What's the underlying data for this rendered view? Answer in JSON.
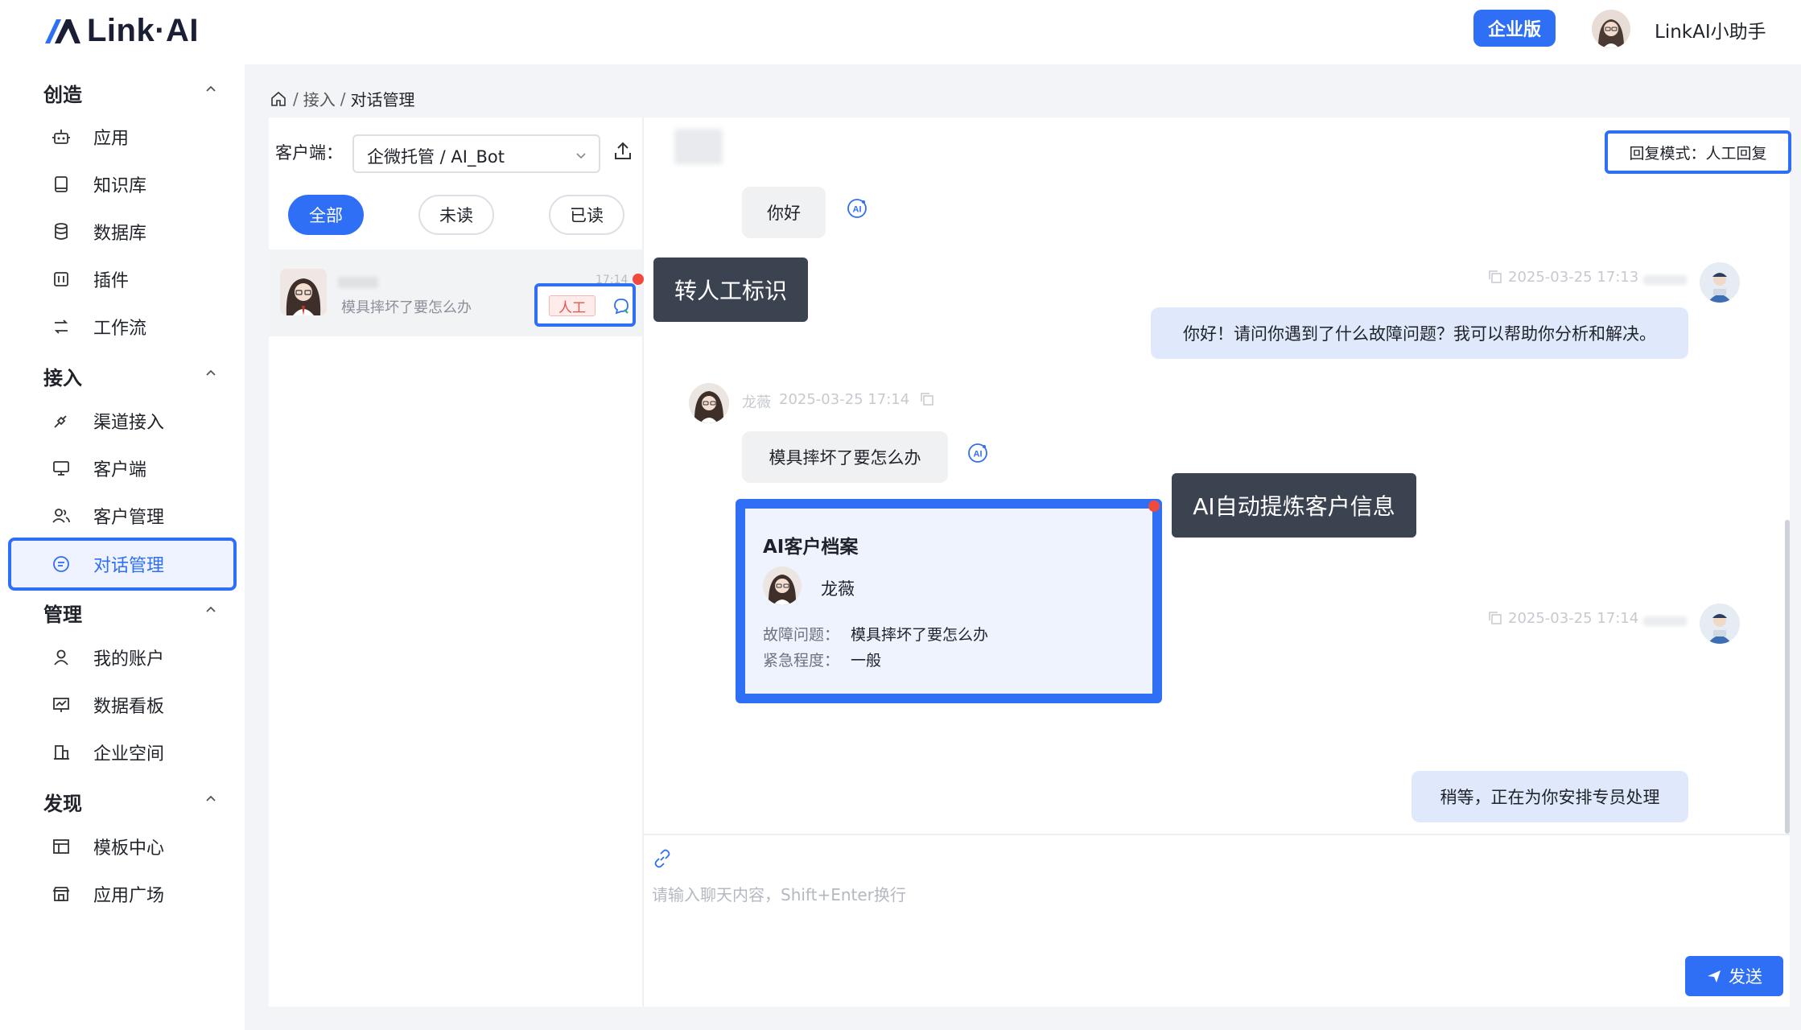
{
  "app": {
    "logo_text": "Link·AI"
  },
  "header": {
    "enterprise_label": "企业版",
    "username": "LinkAI小助手"
  },
  "sidebar": {
    "groups": [
      {
        "title": "创造",
        "items": [
          {
            "label": "应用",
            "icon": "robot-icon"
          },
          {
            "label": "知识库",
            "icon": "book-icon"
          },
          {
            "label": "数据库",
            "icon": "database-icon"
          },
          {
            "label": "插件",
            "icon": "plugin-icon"
          },
          {
            "label": "工作流",
            "icon": "workflow-icon"
          }
        ]
      },
      {
        "title": "接入",
        "items": [
          {
            "label": "渠道接入",
            "icon": "plug-icon"
          },
          {
            "label": "客户端",
            "icon": "monitor-icon"
          },
          {
            "label": "客户管理",
            "icon": "users-icon"
          },
          {
            "label": "对话管理",
            "icon": "chat-icon",
            "active": true
          }
        ]
      },
      {
        "title": "管理",
        "items": [
          {
            "label": "我的账户",
            "icon": "user-icon"
          },
          {
            "label": "数据看板",
            "icon": "chart-board-icon"
          },
          {
            "label": "企业空间",
            "icon": "building-icon"
          }
        ]
      },
      {
        "title": "发现",
        "items": [
          {
            "label": "模板中心",
            "icon": "template-icon"
          },
          {
            "label": "应用广场",
            "icon": "store-icon"
          }
        ]
      }
    ]
  },
  "breadcrumb": {
    "items": [
      "接入",
      "对话管理"
    ]
  },
  "conversation_list": {
    "client_label": "客户端：",
    "client_value": "企微托管 / AI_Bot",
    "filters": [
      "全部",
      "未读",
      "已读"
    ],
    "active_filter": "全部",
    "items": [
      {
        "preview": "模具摔坏了要怎么办",
        "time": "17:14",
        "tag": "人工"
      }
    ]
  },
  "callouts": {
    "human_flag": "转人工标识",
    "ai_profile": "AI自动提炼客户信息"
  },
  "chat": {
    "reply_mode": "回复模式：人工回复",
    "messages": [
      {
        "side": "left",
        "text": "你好"
      },
      {
        "side": "right",
        "time": "2025-03-25 17:13",
        "text": "你好！请问你遇到了什么故障问题？我可以帮助你分析和解决。"
      },
      {
        "side": "left",
        "sender": "龙薇",
        "time": "2025-03-25 17:14",
        "text": "模具摔坏了要怎么办"
      },
      {
        "side": "right",
        "time": "2025-03-25 17:14",
        "text": "稍等，正在为你安排专员处理"
      }
    ],
    "profile_card": {
      "title": "AI客户档案",
      "name": "龙薇",
      "fields": [
        {
          "key": "故障问题：",
          "value": "模具摔坏了要怎么办"
        },
        {
          "key": "紧急程度：",
          "value": "一般"
        }
      ]
    },
    "input_placeholder": "请输入聊天内容，Shift+Enter换行",
    "send_label": "发送"
  },
  "colors": {
    "primary": "#2f6ff5",
    "tag_red": "#e5554b",
    "callout_bg": "#3b4250"
  }
}
